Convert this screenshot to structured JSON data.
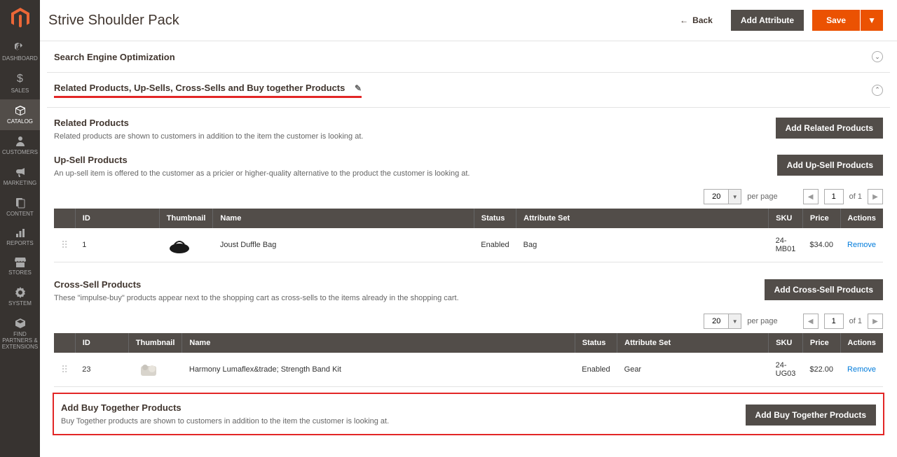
{
  "header": {
    "page_title": "Strive Shoulder Pack",
    "back_label": "Back",
    "add_attribute_label": "Add Attribute",
    "save_label": "Save"
  },
  "nav": {
    "dashboard": "DASHBOARD",
    "sales": "SALES",
    "catalog": "CATALOG",
    "customers": "CUSTOMERS",
    "marketing": "MARKETING",
    "content": "CONTENT",
    "reports": "REPORTS",
    "stores": "STORES",
    "system": "SYSTEM",
    "partners": "FIND PARTNERS & EXTENSIONS"
  },
  "sections": {
    "seo": {
      "title": "Search Engine Optimization"
    },
    "related": {
      "title": "Related Products, Up-Sells, Cross-Sells and Buy together Products",
      "related_products": {
        "title": "Related Products",
        "desc": "Related products are shown to customers in addition to the item the customer is looking at.",
        "button": "Add Related Products"
      },
      "upsell": {
        "title": "Up-Sell Products",
        "desc": "An up-sell item is offered to the customer as a pricier or higher-quality alternative to the product the customer is looking at.",
        "button": "Add Up-Sell Products"
      },
      "crosssell": {
        "title": "Cross-Sell Products",
        "desc": "These \"impulse-buy\" products appear next to the shopping cart as cross-sells to the items already in the shopping cart.",
        "button": "Add Cross-Sell Products"
      },
      "buytogether": {
        "title": "Add Buy Together Products",
        "desc": "Buy Together products are shown to customers in addition to the item the customer is looking at.",
        "button": "Add Buy Together Products"
      }
    }
  },
  "table_headers": {
    "id": "ID",
    "thumbnail": "Thumbnail",
    "name": "Name",
    "status": "Status",
    "attribute_set": "Attribute Set",
    "sku": "SKU",
    "price": "Price",
    "actions": "Actions"
  },
  "pagination": {
    "per_page_value": "20",
    "per_page_label": "per page",
    "page_value": "1",
    "of_label": "of 1"
  },
  "upsell_rows": [
    {
      "id": "1",
      "name": "Joust Duffle Bag",
      "status": "Enabled",
      "attr_set": "Bag",
      "sku": "24-MB01",
      "price": "$34.00",
      "action": "Remove"
    }
  ],
  "crosssell_rows": [
    {
      "id": "23",
      "name": "Harmony Lumaflex&trade; Strength Band Kit",
      "status": "Enabled",
      "attr_set": "Gear",
      "sku": "24-UG03",
      "price": "$22.00",
      "action": "Remove"
    }
  ]
}
